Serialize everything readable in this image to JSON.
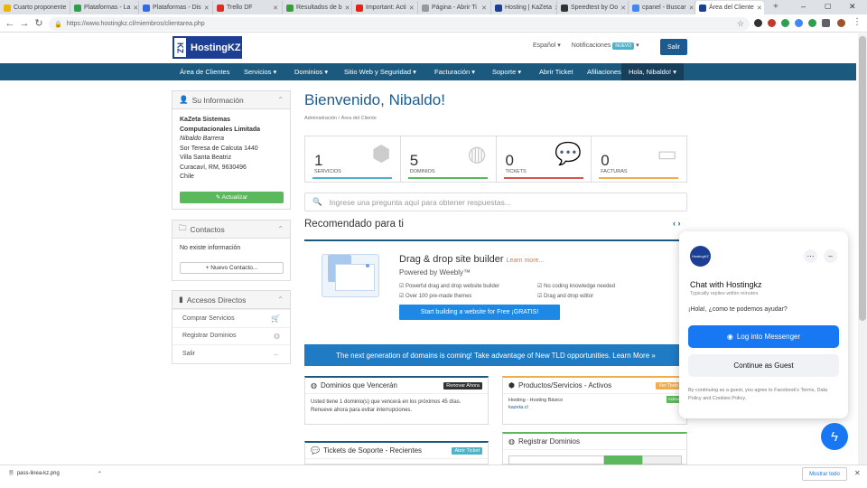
{
  "browser": {
    "tabs": [
      {
        "label": "Cuarto proponente",
        "color": "#f0b400"
      },
      {
        "label": "Plataformas - La",
        "color": "#2e9e4f"
      },
      {
        "label": "Plataformas - Dis",
        "color": "#2e6ee0"
      },
      {
        "label": "Trello DF",
        "color": "#d93025"
      },
      {
        "label": "Resultados de b",
        "color": "#3c9b3c"
      },
      {
        "label": "Important: Acti",
        "color": "#e62117"
      },
      {
        "label": "Página - Abrir Ti",
        "color": "#999999"
      },
      {
        "label": "Hosting | KaZeta",
        "color": "#1c3f94"
      },
      {
        "label": "Speedtest by Oo",
        "color": "#333333"
      },
      {
        "label": "cpanel - Buscar",
        "color": "#4285f4"
      },
      {
        "label": "Área del Cliente",
        "color": "#1c3f94"
      }
    ],
    "url": "https://www.hostingkz.cl/miembros/clientarea.php"
  },
  "header": {
    "logo_kz": "KZ",
    "logo_name": "HostingKZ",
    "language": "Español",
    "notifications": "Notificaciones",
    "new_badge": "NUEVO",
    "logout": "Salir"
  },
  "nav": {
    "items": [
      "Área de Clientes",
      "Servicios ▾",
      "Dominios ▾",
      "Sitio Web y Seguridad ▾",
      "Facturación ▾",
      "Soporte ▾",
      "Abrir Ticket",
      "Afiliaciones"
    ],
    "user": "Hola, Nibaldo! ▾"
  },
  "sidebar": {
    "info_title": "Su Información",
    "company": "KaZeta Sistemas Computacionales Limitada",
    "person": "Nibaldo Barrera",
    "address1": "Sor Teresa de Calcuta 1440",
    "address2": "Villa Santa Beatriz",
    "address3": "Curacaví, RM, 9630496",
    "country": "Chile",
    "update_btn": "✎ Actualizar",
    "contacts_title": "Contactos",
    "contacts_empty": "No existe información",
    "new_contact_btn": "+ Nuevo Contacto...",
    "shortcuts_title": "Accesos Directos",
    "shortcuts": [
      "Comprar Servicios",
      "Registrar Dominios",
      "Salir"
    ]
  },
  "main": {
    "welcome": "Bienvenido, Nibaldo!",
    "breadcrumb": "Administración  /  Área del Cliente",
    "stats": [
      {
        "value": "1",
        "label": "SERVICIOS",
        "color": "#4eb2c9"
      },
      {
        "value": "5",
        "label": "DOMINIOS",
        "color": "#5cb85c"
      },
      {
        "value": "0",
        "label": "TICKETS",
        "color": "#d9534f"
      },
      {
        "value": "0",
        "label": "FACTURAS",
        "color": "#f0ad4e"
      }
    ],
    "kb_placeholder": "Ingrese una pregunta aquí para obtener respuestas...",
    "recommended": "Recomendado para ti",
    "weebly_title": "Drag & drop site builder",
    "weebly_learn": "Learn more...",
    "weebly_sub": "Powered by Weebly™",
    "weebly_features": [
      "Powerful drag and drop website builder",
      "No coding knowledge needed",
      "Over 100 pre-made themes",
      "Drag and drop editor"
    ],
    "weebly_btn": "Start building a website for Free ¡GRATIS!",
    "tld_banner": "The next generation of domains is coming! Take advantage of New TLD opportunities. Learn More »",
    "domains_card": {
      "title": "Dominios que Vencerán",
      "tag": "Renovar Ahora",
      "text": "Usted tiene 1 dominio(s) que vencerá en los próximos 45 días. Renueve ahora para evitar interrupciones."
    },
    "products_card": {
      "title": "Productos/Servicios - Activos",
      "tag": "Ver Todo",
      "item": "Hosting - Hosting Básico",
      "item_domain": "kazeta.cl",
      "item_status": "Activo"
    },
    "tickets_card": {
      "title": "Tickets de Soporte - Recientes",
      "tag": "Abrir Ticket"
    },
    "register_card": {
      "title": "Registrar Dominios"
    }
  },
  "chat": {
    "avatar": "HostingKZ",
    "name": "Chat with Hostingkz",
    "sub": "Typically replies within minutes",
    "msg": "¡Hola!, ¿como te podemos ayudar?",
    "messenger_btn": "Log into Messenger",
    "guest_btn": "Continue as Guest",
    "terms": "By continuing as a guest, you agree to Facebook's Terms, Data Policy and Cookies Policy."
  },
  "downloads": {
    "file": "pass-linea-kz.png",
    "show_all": "Mostrar todo"
  }
}
